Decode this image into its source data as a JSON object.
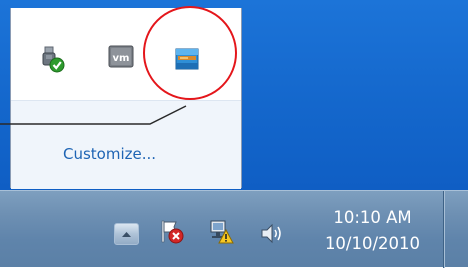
{
  "flyout": {
    "icons": [
      {
        "name": "usb-device-ok-icon"
      },
      {
        "name": "vmware-icon",
        "text": "vm"
      },
      {
        "name": "app-tray-icon"
      }
    ],
    "customize_label": "Customize..."
  },
  "taskbar": {
    "clock_time": "10:10 AM",
    "clock_date": "10/10/2010",
    "icons": [
      "show-hidden-icons-arrow",
      "action-center-flag-icon",
      "network-warning-icon",
      "volume-icon"
    ]
  },
  "colors": {
    "desktop": "#1467cc",
    "callout": "#e4161b",
    "link": "#1e64b4",
    "taskbar": "#6e90b3"
  }
}
